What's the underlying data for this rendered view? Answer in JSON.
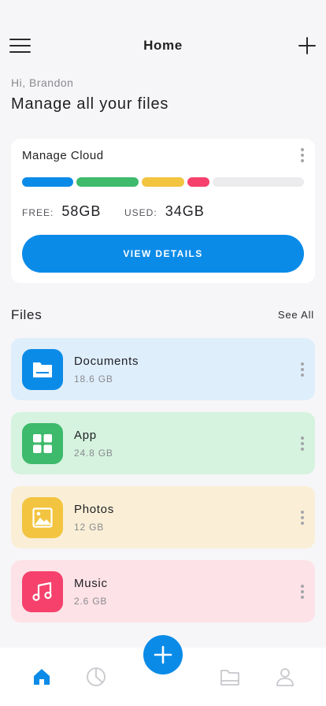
{
  "header": {
    "title": "Home"
  },
  "greeting": "Hi, Brandon",
  "headline": "Manage all your files",
  "cloud": {
    "title": "Manage Cloud",
    "free_label": "FREE:",
    "free_value": "58GB",
    "used_label": "USED:",
    "used_value": "34GB",
    "button_label": "VIEW DETAILS",
    "usage_segments": [
      {
        "color": "#0b8be8",
        "fraction": 0.19
      },
      {
        "color": "#3dba6b",
        "fraction": 0.23
      },
      {
        "color": "#f2c440",
        "fraction": 0.16
      },
      {
        "color": "#f5416c",
        "fraction": 0.08
      },
      {
        "color": "#ececef",
        "fraction": 0.34
      }
    ]
  },
  "files": {
    "title": "Files",
    "see_all": "See All",
    "items": [
      {
        "name": "Documents",
        "size": "18.6 GB",
        "icon": "folder-icon",
        "accent": "#0b8be8",
        "bg": "#dfeefb"
      },
      {
        "name": "App",
        "size": "24.8 GB",
        "icon": "grid-icon",
        "accent": "#3dba6b",
        "bg": "#d5f3df"
      },
      {
        "name": "Photos",
        "size": "12 GB",
        "icon": "image-icon",
        "accent": "#f2c440",
        "bg": "#faefd6"
      },
      {
        "name": "Music",
        "size": "2.6 GB",
        "icon": "music-icon",
        "accent": "#f5416c",
        "bg": "#fde2e7"
      }
    ]
  },
  "nav": {
    "items": [
      "home-icon",
      "pie-chart-icon",
      "folder-icon",
      "user-icon"
    ],
    "active_color": "#0b8be8",
    "inactive_color": "#c8c8cd"
  }
}
